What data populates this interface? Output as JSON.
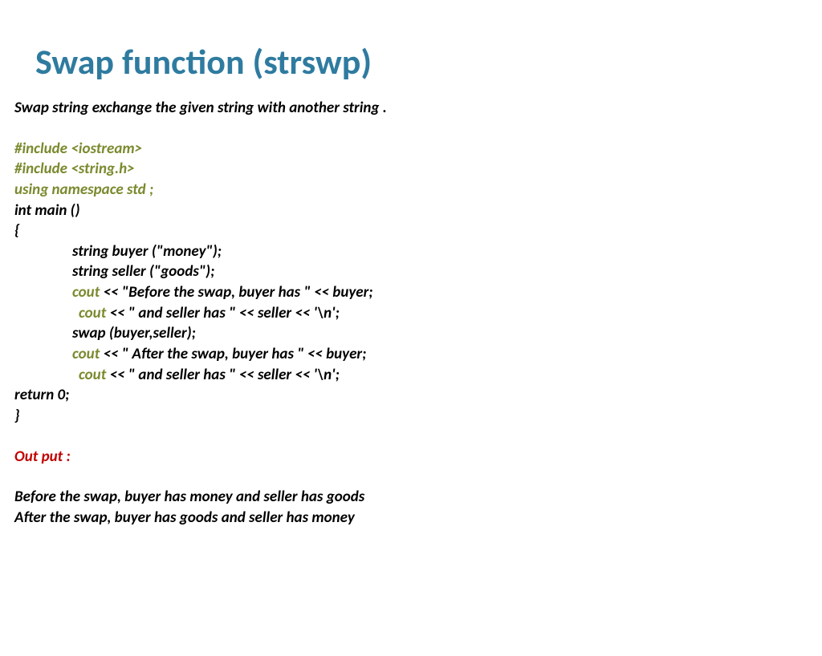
{
  "title": "Swap function (strswp)",
  "desc": "Swap string exchange the given string with another string .",
  "inc1": "#include <iostream>",
  "inc2": "#include <string.h>",
  "ns": "using namespace std ;",
  "main_sig": "int main ()",
  "brace_open": "{",
  "l_buyer": "string buyer (\"money\");",
  "l_seller": "string seller (\"goods\");",
  "kw_cout": "cout",
  "l_before1": " << \"Before the swap, buyer has \" << buyer;",
  "l_before2": " << \" and seller has \" << seller << '\\n';",
  "l_swap": " swap (buyer,seller);",
  "l_after1": " << \" After the swap, buyer has \" << buyer;",
  "l_after2": " << \" and seller has \" << seller << '\\n';",
  "l_return": " return 0;",
  "brace_close": "}",
  "output_label": "Out put :",
  "out1": "Before the swap, buyer has money  and seller has goods",
  "out2": "After the swap, buyer has goods and seller has money"
}
